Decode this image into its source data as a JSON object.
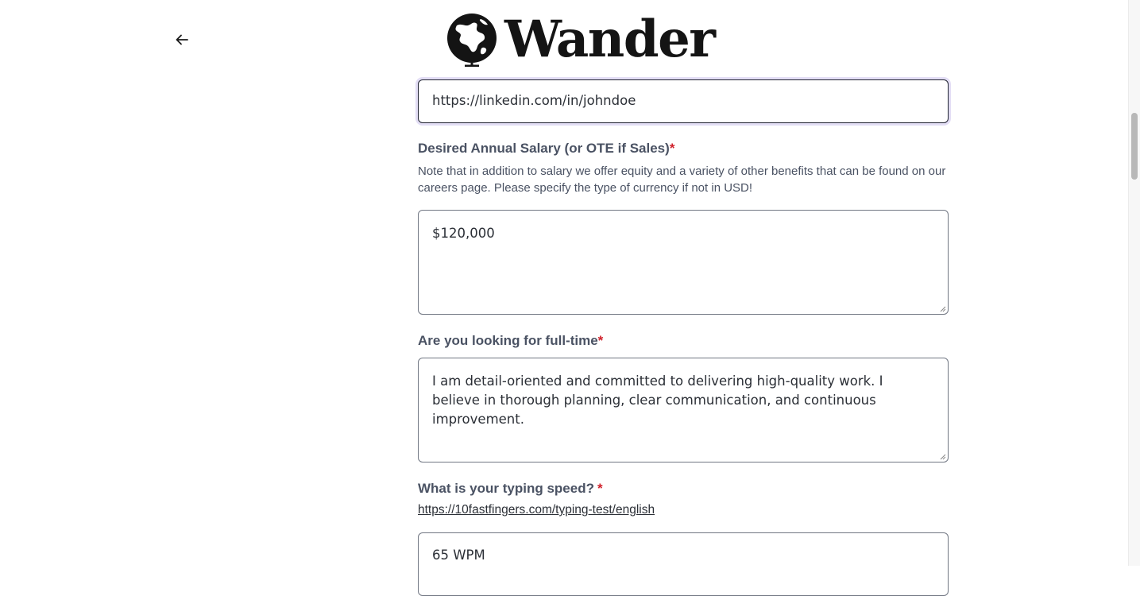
{
  "header": {
    "back_icon": "arrow-left-icon",
    "logo_icon": "globe-icon",
    "logo_text": "Wander"
  },
  "form": {
    "linkedin": {
      "value": "https://linkedin.com/in/johndoe"
    },
    "salary": {
      "label": "Desired Annual Salary (or OTE if Sales)",
      "required_mark": "*",
      "note": "Note that in addition to salary we offer equity and a variety of other benefits that can be found on our careers page. Please specify the type of currency if not in USD!",
      "value": "$120,000"
    },
    "fulltime": {
      "label": "Are you looking for full-time",
      "required_mark": "*",
      "value": "I am detail-oriented and committed to delivering high-quality work. I believe in thorough planning, clear communication, and continuous improvement."
    },
    "typing": {
      "label": "What is your typing speed?",
      "required_mark": "*",
      "link": "https://10fastfingers.com/typing-test/english",
      "value": "65 WPM"
    }
  },
  "colors": {
    "required": "#d0202a",
    "focus_ring": "#e3def5"
  }
}
